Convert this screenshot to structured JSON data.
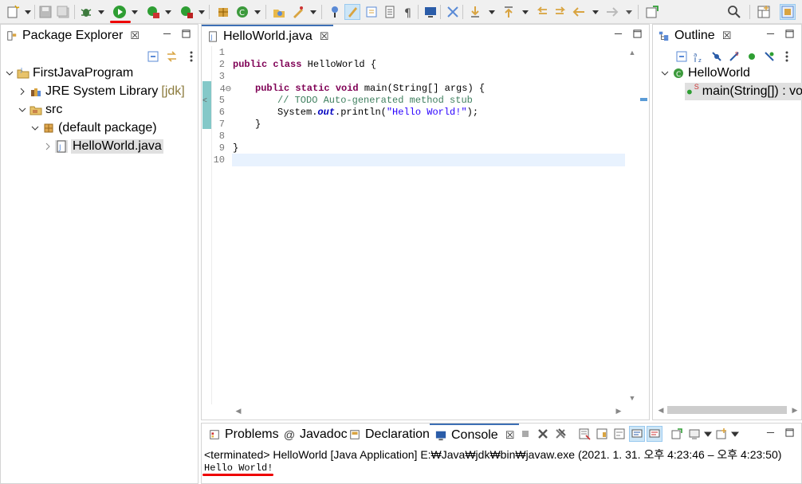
{
  "package_explorer": {
    "title": "Package Explorer",
    "tree": [
      {
        "label": "FirstJavaProgram",
        "expanded": true
      },
      {
        "label": "JRE System Library",
        "decoration": "[jdk]",
        "expanded": false
      },
      {
        "label": "src",
        "expanded": true
      },
      {
        "label": "(default package)",
        "expanded": true
      },
      {
        "label": "HelloWorld.java",
        "selected": true,
        "expanded": false
      }
    ]
  },
  "editor": {
    "tab_title": "HelloWorld.java",
    "line_numbers": [
      "1",
      "2",
      "3",
      "4⊖",
      "5",
      "6",
      "7",
      "8",
      "9",
      "10"
    ],
    "code": {
      "l2_kw": "public class",
      "l2_rest": " HelloWorld {",
      "l4_kw": "public static void",
      "l4_rest": " main(String[] args) {",
      "l5": "// TODO Auto-generated method stub",
      "l6_a": "System.",
      "l6_field": "out",
      "l6_b": ".println(",
      "l6_str": "\"Hello World!\"",
      "l6_c": ");",
      "l7": "}",
      "l9": "}"
    }
  },
  "outline": {
    "title": "Outline",
    "class_name": "HelloWorld",
    "method": "main(String[]) : vo",
    "static_marker": "S"
  },
  "bottom": {
    "tabs": [
      "Problems",
      "Javadoc",
      "Declaration",
      "Console"
    ],
    "active_tab": "Console",
    "terminated_line": "<terminated> HelloWorld [Java Application] E:₩Java₩jdk₩bin₩javaw.exe  (2021. 1. 31. 오후 4:23:46 – 오후 4:23:50)",
    "output": "Hello World!"
  },
  "colors": {
    "accent_red": "#e00000",
    "keyword": "#7f0055",
    "comment": "#3f7f5f",
    "string": "#2a00ff",
    "run_green": "#2e9e33"
  }
}
